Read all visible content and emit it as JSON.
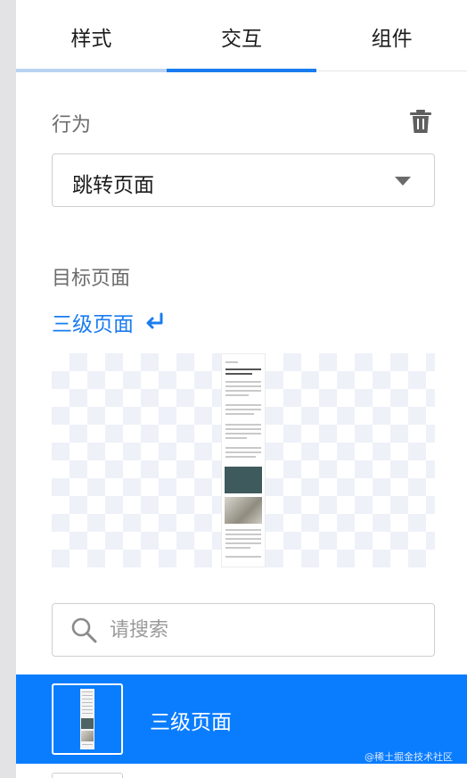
{
  "tabs": [
    {
      "label": "样式"
    },
    {
      "label": "交互"
    },
    {
      "label": "组件"
    }
  ],
  "active_tab": "交互",
  "behavior": {
    "label": "行为",
    "delete_icon": "trash-icon",
    "select_value": "跳转页面"
  },
  "target_page": {
    "label": "目标页面",
    "link_text": "三级页面",
    "link_icon": "enter-arrow-icon"
  },
  "search": {
    "placeholder": "请搜索",
    "value": "",
    "icon": "search-icon"
  },
  "page_list": [
    {
      "name": "三级页面",
      "selected": true
    }
  ],
  "watermark": "@稀土掘金技术社区",
  "colors": {
    "accent": "#1a7cf0",
    "selected_row": "#0a7dff",
    "label_gray": "#6c6c6c"
  }
}
